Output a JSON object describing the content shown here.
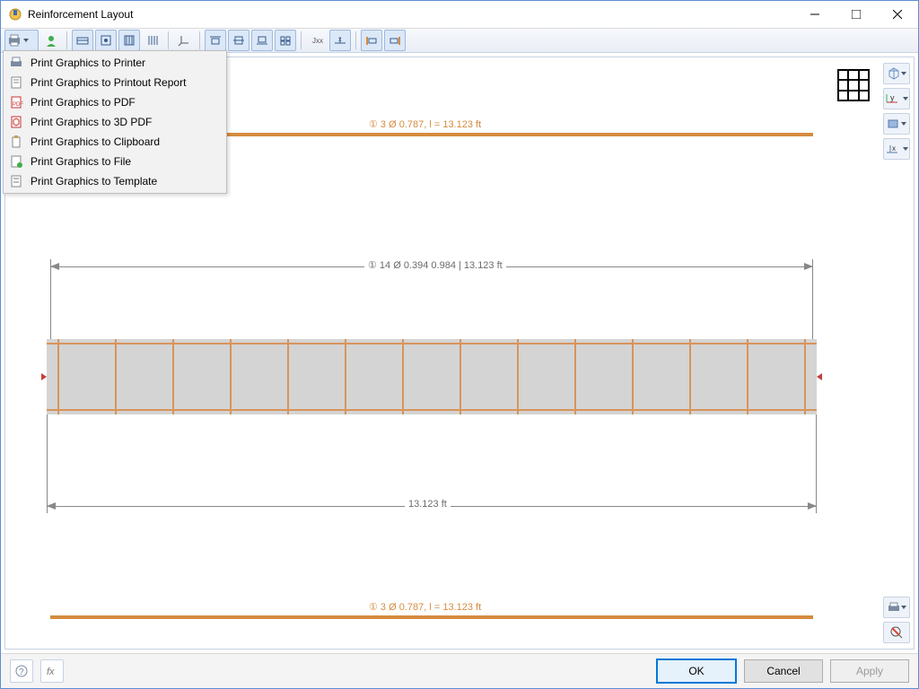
{
  "window": {
    "title": "Reinforcement Layout"
  },
  "colors": {
    "rebar": "#d58b3f",
    "beam_fill": "#d4d4d4",
    "dim": "#6b6b6b"
  },
  "menu": {
    "items": [
      "Print Graphics to Printer",
      "Print Graphics to Printout Report",
      "Print Graphics to PDF",
      "Print Graphics to 3D PDF",
      "Print Graphics to Clipboard",
      "Print Graphics to File",
      "Print Graphics to Template"
    ]
  },
  "drawing": {
    "top_bar_label": "① 3 Ø 0.787, l = 13.123 ft",
    "stirrup_label": "① 14 Ø 0.394 0.984 | 13.123 ft",
    "span_label": "13.123 ft",
    "bottom_bar_label": "① 3 Ø 0.787, l = 13.123 ft"
  },
  "footer": {
    "ok": "OK",
    "cancel": "Cancel",
    "apply": "Apply"
  },
  "right_axis_label": "y"
}
